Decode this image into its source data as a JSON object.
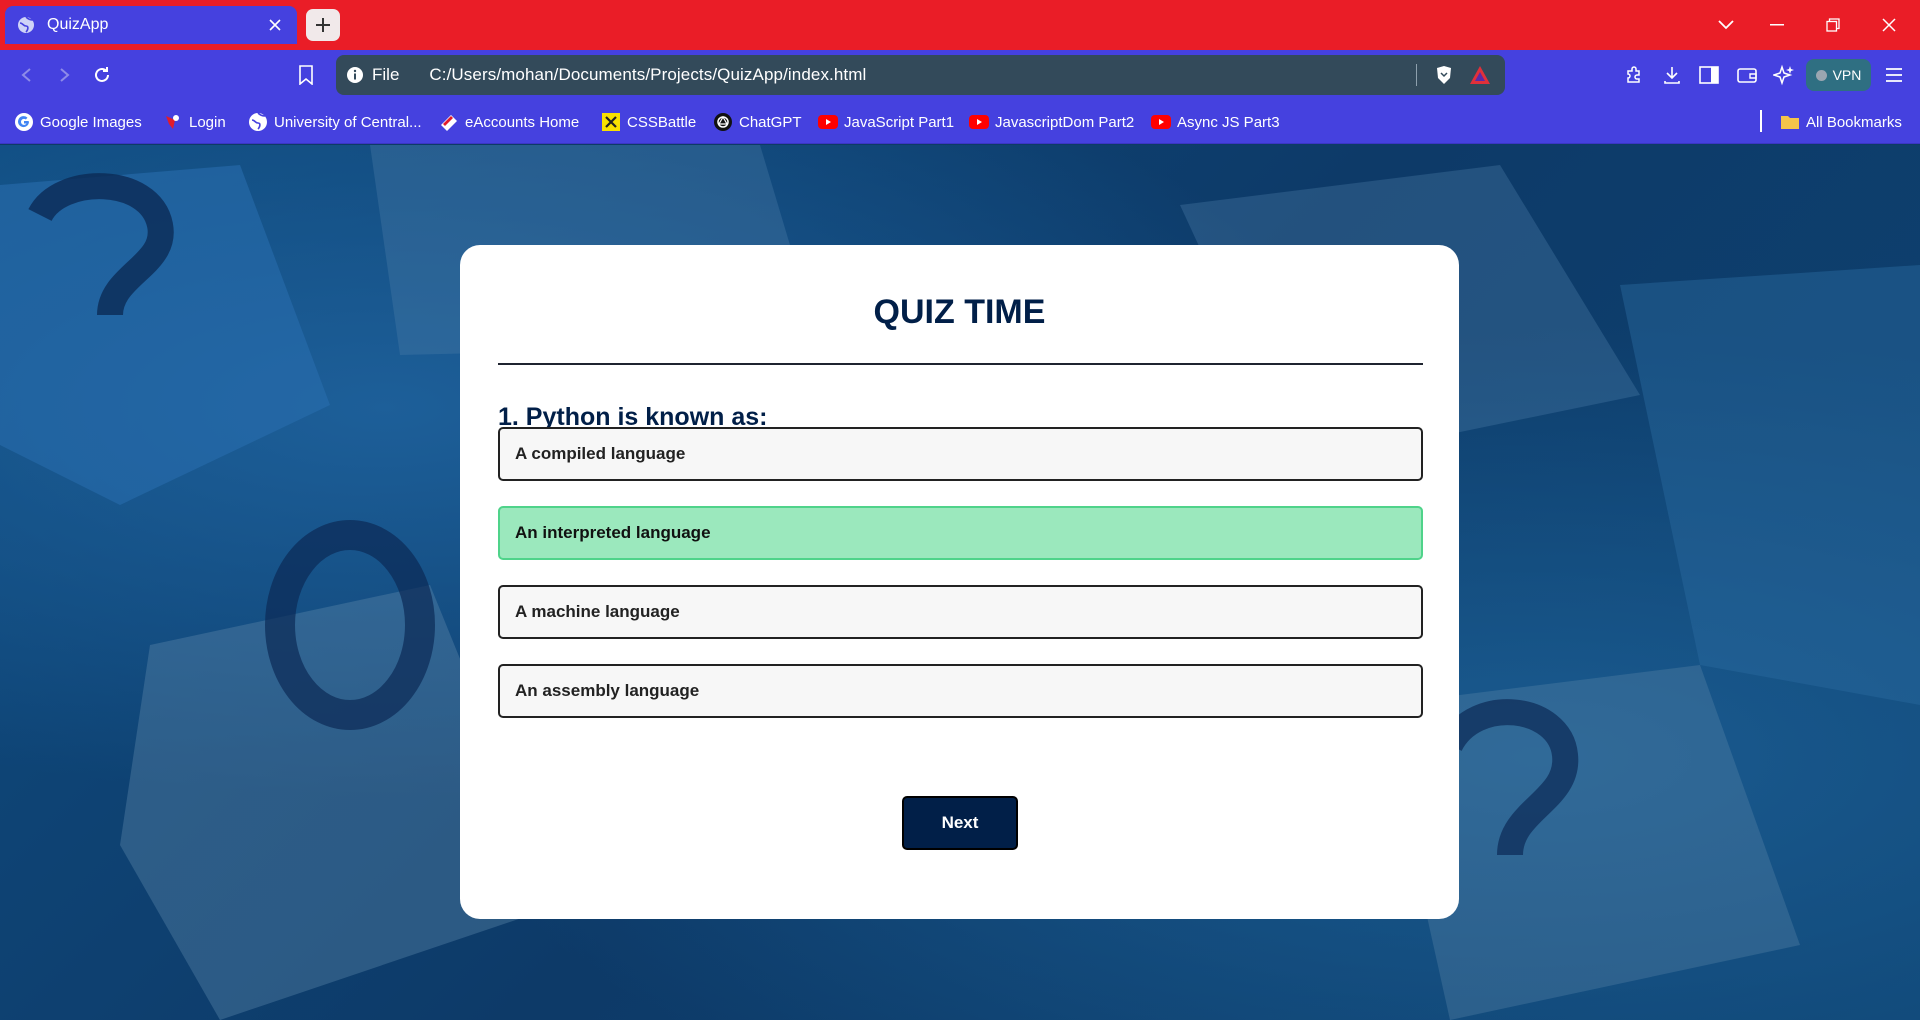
{
  "browser": {
    "tab_title": "QuizApp",
    "omnibox": {
      "scheme_label": "File",
      "url": "C:/Users/mohan/Documents/Projects/QuizApp/index.html"
    },
    "vpn_label": "VPN",
    "bookmarks": [
      {
        "label": "Google Images",
        "icon": "google-icon"
      },
      {
        "label": "Login",
        "icon": "login-favicon"
      },
      {
        "label": "University of Central...",
        "icon": "globe-icon"
      },
      {
        "label": "eAccounts Home",
        "icon": "eaccounts-favicon"
      },
      {
        "label": "CSSBattle",
        "icon": "cssbattle-favicon"
      },
      {
        "label": "ChatGPT",
        "icon": "chatgpt-icon"
      },
      {
        "label": "JavaScript Part1",
        "icon": "youtube-icon"
      },
      {
        "label": "JavascriptDom Part2",
        "icon": "youtube-icon"
      },
      {
        "label": "Async JS Part3",
        "icon": "youtube-icon"
      }
    ],
    "all_bookmarks_label": "All Bookmarks",
    "colors": {
      "titlebar": "#ea1d27",
      "toolbar": "#4541df",
      "omnibox": "#334a5a"
    }
  },
  "quiz": {
    "title": "QUIZ TIME",
    "question": "1. Python is known as:",
    "answers": [
      {
        "label": "A compiled language",
        "state": "default"
      },
      {
        "label": "An interpreted language",
        "state": "correct"
      },
      {
        "label": "A machine language",
        "state": "default"
      },
      {
        "label": "An assembly language",
        "state": "default"
      }
    ],
    "next_label": "Next",
    "colors": {
      "heading": "#011f48",
      "correct_bg": "#9be8bd",
      "correct_border": "#4fd38a",
      "button_bg": "#011f48"
    }
  }
}
